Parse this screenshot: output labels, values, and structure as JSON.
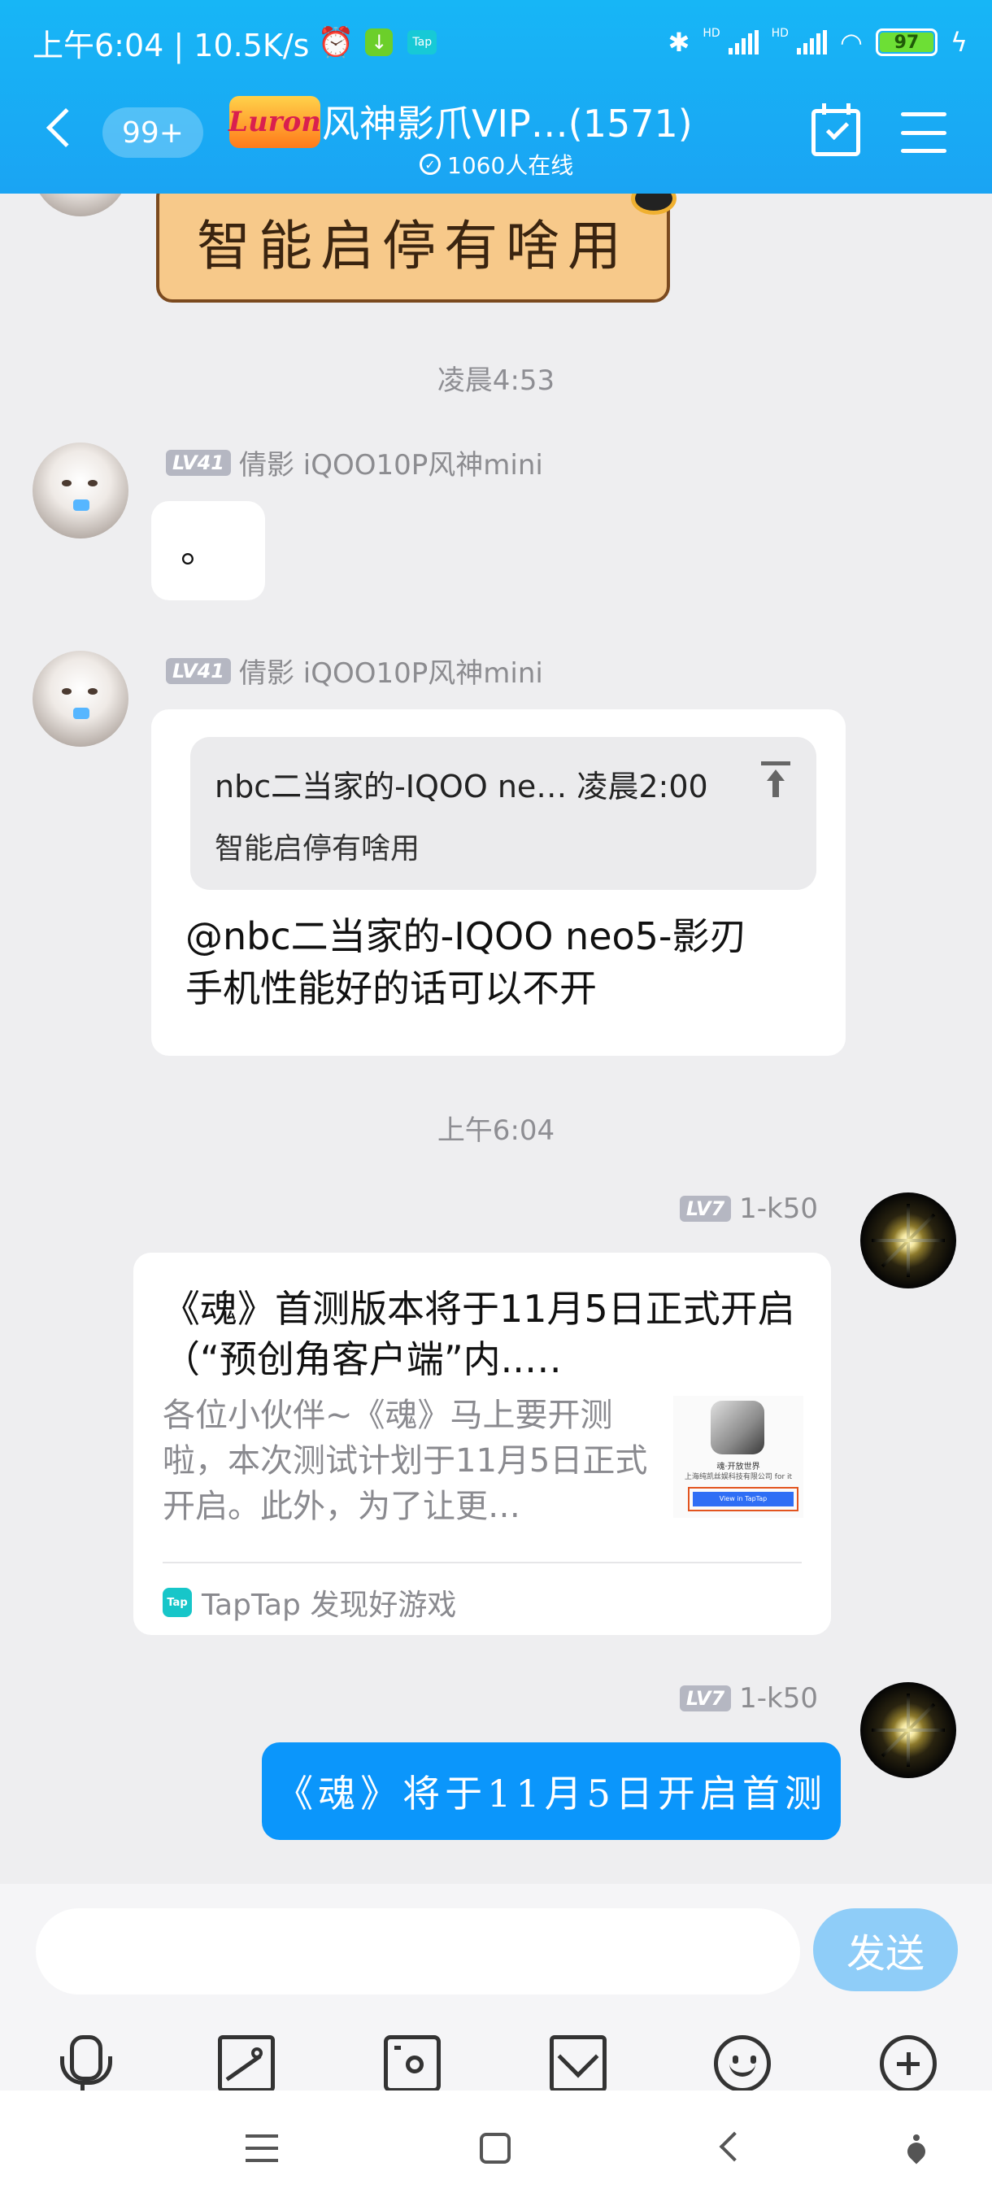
{
  "status_bar": {
    "time_speed": "上午6:04 | 10.5K/s",
    "tap_label": "Tap",
    "signal_label": "HD",
    "battery": "97"
  },
  "header": {
    "unread_badge": "99+",
    "logo_text": "Luron",
    "group_title": "风神影爪VIP…(1571)",
    "online_count": "1060人在线"
  },
  "messages": {
    "sticker_text": "智能启停有啥用",
    "time_1": "凌晨4:53",
    "msg1": {
      "level": "LV41",
      "sender": "倩影 iQOO10P风神mini",
      "text": "。"
    },
    "msg2": {
      "level": "LV41",
      "sender": "倩影 iQOO10P风神mini",
      "quote_header": "nbc二当家的-IQOO ne… 凌晨2:00",
      "quote_text": "智能启停有啥用",
      "text_line1": "@nbc二当家的-IQOO neo5-影刃",
      "text_line2": "手机性能好的话可以不开"
    },
    "time_2": "上午6:04",
    "msg3": {
      "level": "LV7",
      "sender": "1-k50",
      "card_title": "《魂》首测版本将于11月5日正式开启（“预创角客户端”内..…",
      "card_desc": "各位小伙伴~《魂》马上要开测啦，本次测试计划于11月5日正式开启。此外，为了让更…",
      "thumb_line1": "魂·开放世界",
      "thumb_line2": "上海纯凯丝娱科技有限公司 for it",
      "thumb_button": "View in TapTap",
      "source_icon_label": "Tap",
      "card_source": "TapTap 发现好游戏"
    },
    "msg4": {
      "level": "LV7",
      "sender": "1-k50",
      "text": "《魂》将于11月5日开启首测"
    }
  },
  "input_bar": {
    "placeholder": "",
    "send_label": "发送",
    "tools": [
      "mic-icon",
      "photo-icon",
      "camera-icon",
      "red-packet-icon",
      "emoji-icon",
      "plus-icon"
    ]
  },
  "colors": {
    "header_blue": "#17b6f6",
    "bubble_blue": "#0b96fb",
    "send_button": "#8fcdf8",
    "chat_bg": "#eeeef0"
  }
}
